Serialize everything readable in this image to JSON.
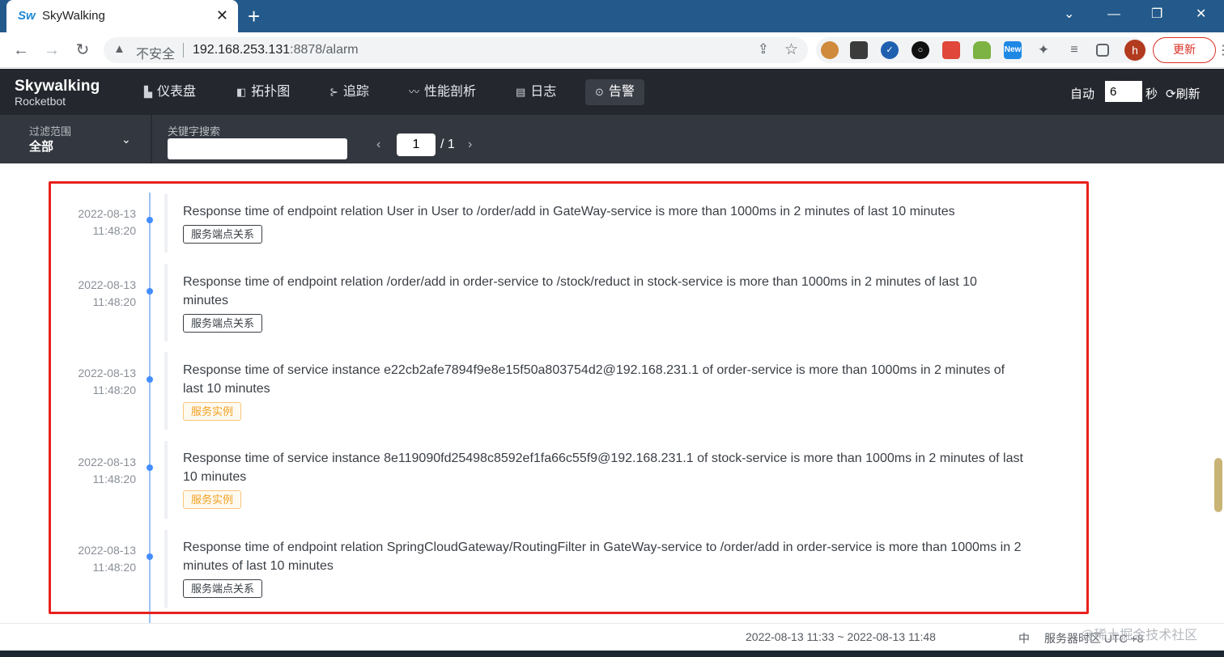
{
  "browser": {
    "tab_title": "SkyWalking",
    "favicon_text": "Sw",
    "tab_close": "✕",
    "new_tab": "+",
    "window_controls": {
      "dropdown": "⌄",
      "minimize": "—",
      "restore": "❐",
      "close": "✕"
    },
    "nav": {
      "back": "←",
      "forward": "→",
      "reload": "↻"
    },
    "insecure_label": "不安全",
    "url_host": "192.168.253.131",
    "url_rest": ":8878/alarm",
    "avatar_letter": "h",
    "update_label": "更新",
    "extensions": [
      "cookie-icon",
      "qr-code-icon",
      "check-circle-icon",
      "circle-icon",
      "cube-icon",
      "android-icon",
      "new-badge-icon",
      "puzzle-icon",
      "playlist-icon",
      "sidepanel-icon"
    ],
    "new_badge": "New"
  },
  "app": {
    "logo_line1": "Skywalking",
    "logo_line2": "Rocketbot",
    "nav": [
      {
        "label": "仪表盘",
        "icon": "dashboard-icon"
      },
      {
        "label": "拓扑图",
        "icon": "topology-icon"
      },
      {
        "label": "追踪",
        "icon": "trace-icon"
      },
      {
        "label": "性能剖析",
        "icon": "profile-icon"
      },
      {
        "label": "日志",
        "icon": "log-icon"
      },
      {
        "label": "告警",
        "icon": "alarm-icon",
        "active": true
      }
    ],
    "auto_label": "自动",
    "auto_value": "6",
    "auto_unit": "秒",
    "refresh_label": "刷新"
  },
  "filter": {
    "scope_label": "过滤范围",
    "scope_value": "全部",
    "keyword_label": "关键字搜索",
    "keyword_value": "",
    "page_current": "1",
    "page_total": "/ 1"
  },
  "alarms": [
    {
      "date": "2022-08-13",
      "time": "11:48:20",
      "message": "Response time of endpoint relation User in User to /order/add in GateWay-service is more than 1000ms in 2 minutes of last 10 minutes",
      "tag": "服务端点关系",
      "tag_type": "endpoint"
    },
    {
      "date": "2022-08-13",
      "time": "11:48:20",
      "message": "Response time of endpoint relation /order/add in order-service to /stock/reduct in stock-service is more than 1000ms in 2 minutes of last 10 minutes",
      "tag": "服务端点关系",
      "tag_type": "endpoint"
    },
    {
      "date": "2022-08-13",
      "time": "11:48:20",
      "message": "Response time of service instance e22cb2afe7894f9e8e15f50a803754d2@192.168.231.1 of order-service is more than 1000ms in 2 minutes of last 10 minutes",
      "tag": "服务实例",
      "tag_type": "instance"
    },
    {
      "date": "2022-08-13",
      "time": "11:48:20",
      "message": "Response time of service instance 8e119090fd25498c8592ef1fa66c55f9@192.168.231.1 of stock-service is more than 1000ms in 2 minutes of last 10 minutes",
      "tag": "服务实例",
      "tag_type": "instance"
    },
    {
      "date": "2022-08-13",
      "time": "11:48:20",
      "message": "Response time of endpoint relation SpringCloudGateway/RoutingFilter in GateWay-service to /order/add in order-service is more than 1000ms in 2 minutes of last 10 minutes",
      "tag": "服务端点关系",
      "tag_type": "endpoint"
    }
  ],
  "footer": {
    "time_range": "2022-08-13 11:33 ~ 2022-08-13 11:48",
    "language": "中",
    "timezone": "服务器时区 UTC +8",
    "watermark": "@稀土掘金技术社区"
  },
  "colors": {
    "tabstrip": "#245a8b",
    "nav_bg": "#24272e",
    "filter_bg": "#333840",
    "timeline_dot": "#448dfe",
    "highlight_box": "#e8211d",
    "instance_tag": "#f0a020"
  }
}
